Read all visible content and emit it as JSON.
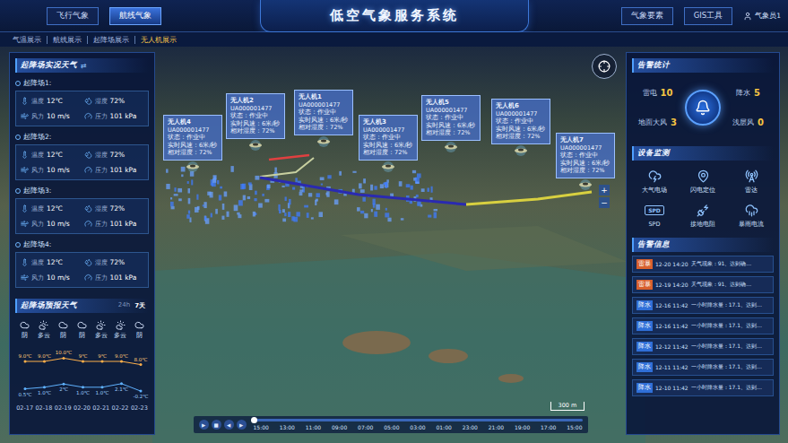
{
  "header": {
    "title": "低空气象服务系统",
    "left_tabs": [
      {
        "label": "飞行气象",
        "selected": false
      },
      {
        "label": "航线气象",
        "selected": true
      }
    ],
    "right_buttons": [
      "气象要素",
      "GIS工具"
    ],
    "user": "气象员1"
  },
  "subnav": [
    {
      "label": "气温展示",
      "selected": false
    },
    {
      "label": "航线展示",
      "selected": false
    },
    {
      "label": "起降场展示",
      "selected": false
    },
    {
      "label": "无人机展示",
      "selected": true
    }
  ],
  "live_weather": {
    "title": "起降场实况天气",
    "toggle": "⇄",
    "sites": [
      {
        "name": "起降场1:",
        "readings": [
          {
            "kind": "temperature",
            "label": "温度",
            "value": "12℃"
          },
          {
            "kind": "humidity",
            "label": "湿度",
            "value": "72%"
          },
          {
            "kind": "wind",
            "label": "风力",
            "value": "10 m/s"
          },
          {
            "kind": "pressure",
            "label": "压力",
            "value": "101 kPa"
          }
        ]
      },
      {
        "name": "起降场2:",
        "readings": [
          {
            "kind": "temperature",
            "label": "温度",
            "value": "12℃"
          },
          {
            "kind": "humidity",
            "label": "湿度",
            "value": "72%"
          },
          {
            "kind": "wind",
            "label": "风力",
            "value": "10 m/s"
          },
          {
            "kind": "pressure",
            "label": "压力",
            "value": "101 kPa"
          }
        ]
      },
      {
        "name": "起降场3:",
        "readings": [
          {
            "kind": "temperature",
            "label": "温度",
            "value": "12℃"
          },
          {
            "kind": "humidity",
            "label": "湿度",
            "value": "72%"
          },
          {
            "kind": "wind",
            "label": "风力",
            "value": "10 m/s"
          },
          {
            "kind": "pressure",
            "label": "压力",
            "value": "101 kPa"
          }
        ]
      },
      {
        "name": "起降场4:",
        "readings": [
          {
            "kind": "temperature",
            "label": "温度",
            "value": "12℃"
          },
          {
            "kind": "humidity",
            "label": "湿度",
            "value": "72%"
          },
          {
            "kind": "wind",
            "label": "风力",
            "value": "10 m/s"
          },
          {
            "kind": "pressure",
            "label": "压力",
            "value": "101 kPa"
          }
        ]
      }
    ]
  },
  "forecast": {
    "title": "起降场预报天气",
    "tabs": [
      {
        "label": "24h",
        "selected": false
      },
      {
        "label": "7天",
        "selected": true
      }
    ],
    "days": [
      {
        "condition": "阴",
        "kind": "overcast"
      },
      {
        "condition": "多云",
        "kind": "partly-cloudy"
      },
      {
        "condition": "阴",
        "kind": "overcast"
      },
      {
        "condition": "阴",
        "kind": "overcast"
      },
      {
        "condition": "多云",
        "kind": "partly-cloudy"
      },
      {
        "condition": "多云",
        "kind": "partly-cloudy"
      },
      {
        "condition": "阴",
        "kind": "overcast"
      }
    ],
    "high": [
      9,
      9,
      10,
      9,
      9,
      9,
      8
    ],
    "high_labels": [
      "9.0℃",
      "9.0℃",
      "10.0℃",
      "9℃",
      "9℃",
      "9.0℃",
      "8.0℃"
    ],
    "low": [
      0.5,
      1,
      2,
      1,
      1,
      2.1,
      -0.2
    ],
    "low_labels": [
      "0.5℃",
      "1.0℃",
      "2℃",
      "1.0℃",
      "1.0℃",
      "2.1℃",
      "-0.2℃"
    ],
    "dates": [
      "02-17",
      "02-18",
      "02-19",
      "02-20",
      "02-21",
      "02-22",
      "02-23"
    ]
  },
  "map": {
    "drones": [
      {
        "name": "无人机4",
        "id": "UA000001477",
        "status": "状态：作业中",
        "wind": "实时风速：6米/秒",
        "humidity": "相对湿度：72%"
      },
      {
        "name": "无人机2",
        "id": "UA000001477",
        "status": "状态：作业中",
        "wind": "实时风速：6米/秒",
        "humidity": "相对湿度：72%"
      },
      {
        "name": "无人机1",
        "id": "UA000001477",
        "status": "状态：作业中",
        "wind": "实时风速：6米/秒",
        "humidity": "相对湿度：72%"
      },
      {
        "name": "无人机3",
        "id": "UA000001477",
        "status": "状态：作业中",
        "wind": "实时风速：6米/秒",
        "humidity": "相对湿度：72%"
      },
      {
        "name": "无人机5",
        "id": "UA000001477",
        "status": "状态：作业中",
        "wind": "实时风速：6米/秒",
        "humidity": "相对湿度：72%"
      },
      {
        "name": "无人机6",
        "id": "UA000001477",
        "status": "状态：作业中",
        "wind": "实时风速：6米/秒",
        "humidity": "相对湿度：72%"
      },
      {
        "name": "无人机7",
        "id": "UA000001477",
        "status": "状态：作业中",
        "wind": "实时风速：6米/秒",
        "humidity": "相对湿度：72%"
      }
    ],
    "zoom": [
      "+",
      "−"
    ],
    "scale": "300 m"
  },
  "timeline": {
    "controls": [
      "▶",
      "■",
      "◀",
      "▶"
    ],
    "level": 0,
    "times": [
      "15:00",
      "13:00",
      "11:00",
      "09:00",
      "07:00",
      "05:00",
      "03:00",
      "01:00",
      "23:00",
      "21:00",
      "19:00",
      "17:00",
      "15:00"
    ]
  },
  "alarm_stats": {
    "title": "告警统计",
    "items": [
      {
        "label": "雷电",
        "count": "10"
      },
      {
        "label": "地面大风",
        "count": "3"
      },
      {
        "label": "降水",
        "count": "5"
      },
      {
        "label": "浅层风",
        "count": "0"
      }
    ]
  },
  "devices": {
    "title": "设备监测",
    "items": [
      {
        "label": "大气电场",
        "kind": "field"
      },
      {
        "label": "闪电定位",
        "kind": "locate"
      },
      {
        "label": "雷达",
        "kind": "radar"
      },
      {
        "label": "SPD",
        "kind": "spd",
        "icon_text": "SPD"
      },
      {
        "label": "接地电阻",
        "kind": "ground"
      },
      {
        "label": "暴雨电流",
        "kind": "current"
      }
    ]
  },
  "alarms": {
    "title": "告警信息",
    "items": [
      {
        "tag": "雷暴",
        "color": "#d8602e",
        "time": "12-20 14:20",
        "text": "天气现象：91、达到确…"
      },
      {
        "tag": "雷暴",
        "color": "#d8602e",
        "time": "12-19 14:20",
        "text": "天气现象：91、达到确…"
      },
      {
        "tag": "降水",
        "color": "#2f6fd8",
        "time": "12-16 11:42",
        "text": "一小时降水量：17.1、达到…"
      },
      {
        "tag": "降水",
        "color": "#2f6fd8",
        "time": "12-16 11:42",
        "text": "一小时降水量：17.1、达到…"
      },
      {
        "tag": "降水",
        "color": "#2f6fd8",
        "time": "12-12 11:42",
        "text": "一小时降水量：17.1、达到…"
      },
      {
        "tag": "降水",
        "color": "#2f6fd8",
        "time": "12-11 11:42",
        "text": "一小时降水量：17.1、达到…"
      },
      {
        "tag": "降水",
        "color": "#2f6fd8",
        "time": "12-10 11:42",
        "text": "一小时降水量：17.1、达到…"
      }
    ]
  }
}
